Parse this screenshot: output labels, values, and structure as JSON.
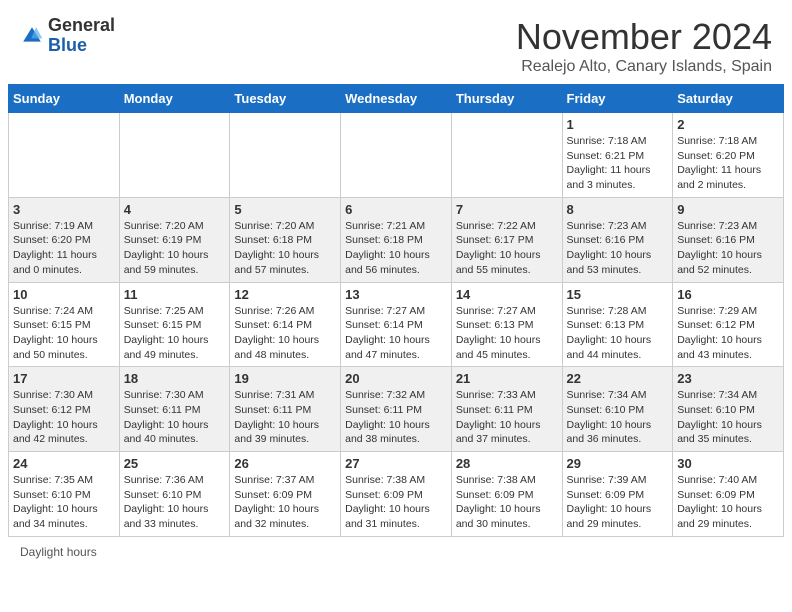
{
  "header": {
    "logo_general": "General",
    "logo_blue": "Blue",
    "month_title": "November 2024",
    "location": "Realejo Alto, Canary Islands, Spain"
  },
  "days_of_week": [
    "Sunday",
    "Monday",
    "Tuesday",
    "Wednesday",
    "Thursday",
    "Friday",
    "Saturday"
  ],
  "weeks": [
    {
      "row_class": "row-odd",
      "days": [
        {
          "num": "",
          "info": "",
          "empty": true
        },
        {
          "num": "",
          "info": "",
          "empty": true
        },
        {
          "num": "",
          "info": "",
          "empty": true
        },
        {
          "num": "",
          "info": "",
          "empty": true
        },
        {
          "num": "",
          "info": "",
          "empty": true
        },
        {
          "num": "1",
          "info": "Sunrise: 7:18 AM\nSunset: 6:21 PM\nDaylight: 11 hours and 3 minutes."
        },
        {
          "num": "2",
          "info": "Sunrise: 7:18 AM\nSunset: 6:20 PM\nDaylight: 11 hours and 2 minutes."
        }
      ]
    },
    {
      "row_class": "row-even",
      "days": [
        {
          "num": "3",
          "info": "Sunrise: 7:19 AM\nSunset: 6:20 PM\nDaylight: 11 hours and 0 minutes."
        },
        {
          "num": "4",
          "info": "Sunrise: 7:20 AM\nSunset: 6:19 PM\nDaylight: 10 hours and 59 minutes."
        },
        {
          "num": "5",
          "info": "Sunrise: 7:20 AM\nSunset: 6:18 PM\nDaylight: 10 hours and 57 minutes."
        },
        {
          "num": "6",
          "info": "Sunrise: 7:21 AM\nSunset: 6:18 PM\nDaylight: 10 hours and 56 minutes."
        },
        {
          "num": "7",
          "info": "Sunrise: 7:22 AM\nSunset: 6:17 PM\nDaylight: 10 hours and 55 minutes."
        },
        {
          "num": "8",
          "info": "Sunrise: 7:23 AM\nSunset: 6:16 PM\nDaylight: 10 hours and 53 minutes."
        },
        {
          "num": "9",
          "info": "Sunrise: 7:23 AM\nSunset: 6:16 PM\nDaylight: 10 hours and 52 minutes."
        }
      ]
    },
    {
      "row_class": "row-odd",
      "days": [
        {
          "num": "10",
          "info": "Sunrise: 7:24 AM\nSunset: 6:15 PM\nDaylight: 10 hours and 50 minutes."
        },
        {
          "num": "11",
          "info": "Sunrise: 7:25 AM\nSunset: 6:15 PM\nDaylight: 10 hours and 49 minutes."
        },
        {
          "num": "12",
          "info": "Sunrise: 7:26 AM\nSunset: 6:14 PM\nDaylight: 10 hours and 48 minutes."
        },
        {
          "num": "13",
          "info": "Sunrise: 7:27 AM\nSunset: 6:14 PM\nDaylight: 10 hours and 47 minutes."
        },
        {
          "num": "14",
          "info": "Sunrise: 7:27 AM\nSunset: 6:13 PM\nDaylight: 10 hours and 45 minutes."
        },
        {
          "num": "15",
          "info": "Sunrise: 7:28 AM\nSunset: 6:13 PM\nDaylight: 10 hours and 44 minutes."
        },
        {
          "num": "16",
          "info": "Sunrise: 7:29 AM\nSunset: 6:12 PM\nDaylight: 10 hours and 43 minutes."
        }
      ]
    },
    {
      "row_class": "row-even",
      "days": [
        {
          "num": "17",
          "info": "Sunrise: 7:30 AM\nSunset: 6:12 PM\nDaylight: 10 hours and 42 minutes."
        },
        {
          "num": "18",
          "info": "Sunrise: 7:30 AM\nSunset: 6:11 PM\nDaylight: 10 hours and 40 minutes."
        },
        {
          "num": "19",
          "info": "Sunrise: 7:31 AM\nSunset: 6:11 PM\nDaylight: 10 hours and 39 minutes."
        },
        {
          "num": "20",
          "info": "Sunrise: 7:32 AM\nSunset: 6:11 PM\nDaylight: 10 hours and 38 minutes."
        },
        {
          "num": "21",
          "info": "Sunrise: 7:33 AM\nSunset: 6:11 PM\nDaylight: 10 hours and 37 minutes."
        },
        {
          "num": "22",
          "info": "Sunrise: 7:34 AM\nSunset: 6:10 PM\nDaylight: 10 hours and 36 minutes."
        },
        {
          "num": "23",
          "info": "Sunrise: 7:34 AM\nSunset: 6:10 PM\nDaylight: 10 hours and 35 minutes."
        }
      ]
    },
    {
      "row_class": "row-odd",
      "days": [
        {
          "num": "24",
          "info": "Sunrise: 7:35 AM\nSunset: 6:10 PM\nDaylight: 10 hours and 34 minutes."
        },
        {
          "num": "25",
          "info": "Sunrise: 7:36 AM\nSunset: 6:10 PM\nDaylight: 10 hours and 33 minutes."
        },
        {
          "num": "26",
          "info": "Sunrise: 7:37 AM\nSunset: 6:09 PM\nDaylight: 10 hours and 32 minutes."
        },
        {
          "num": "27",
          "info": "Sunrise: 7:38 AM\nSunset: 6:09 PM\nDaylight: 10 hours and 31 minutes."
        },
        {
          "num": "28",
          "info": "Sunrise: 7:38 AM\nSunset: 6:09 PM\nDaylight: 10 hours and 30 minutes."
        },
        {
          "num": "29",
          "info": "Sunrise: 7:39 AM\nSunset: 6:09 PM\nDaylight: 10 hours and 29 minutes."
        },
        {
          "num": "30",
          "info": "Sunrise: 7:40 AM\nSunset: 6:09 PM\nDaylight: 10 hours and 29 minutes."
        }
      ]
    }
  ],
  "footer": {
    "daylight_label": "Daylight hours"
  }
}
